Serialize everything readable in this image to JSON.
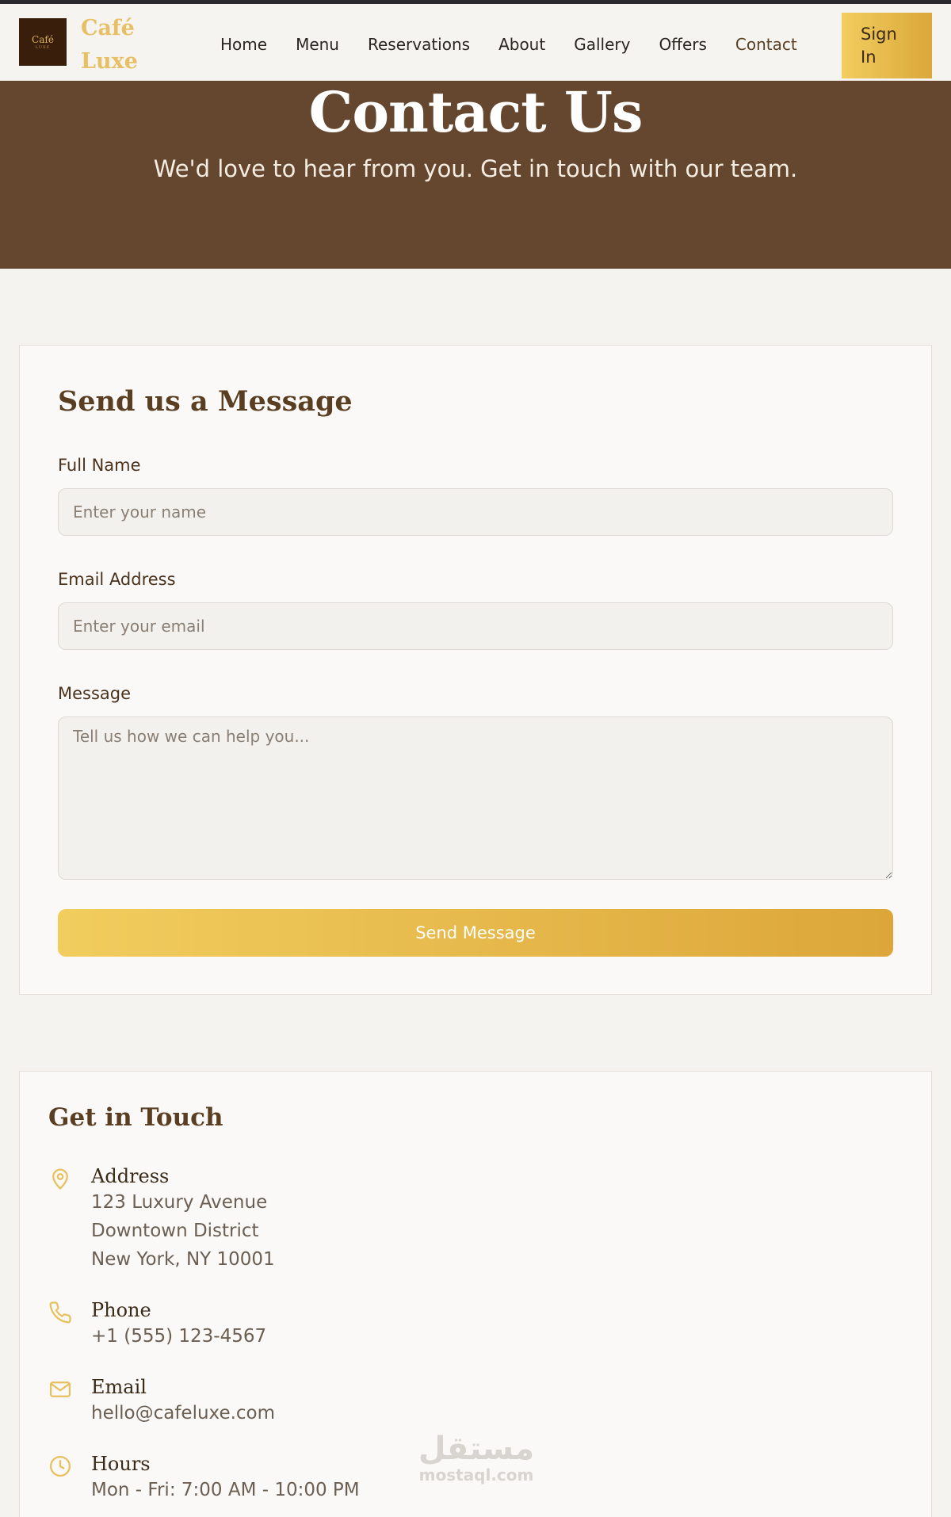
{
  "header": {
    "logo_line1": "Café",
    "logo_line2": "LUXE",
    "brand_line1": "Café",
    "brand_line2": "Luxe",
    "nav": [
      {
        "label": "Home"
      },
      {
        "label": "Menu"
      },
      {
        "label": "Reservations"
      },
      {
        "label": "About"
      },
      {
        "label": "Gallery"
      },
      {
        "label": "Offers"
      },
      {
        "label": "Contact",
        "active": true
      }
    ],
    "sign_in": "Sign In"
  },
  "hero": {
    "title": "Contact Us",
    "subtitle": "We'd love to hear from you. Get in touch with our team."
  },
  "form": {
    "title": "Send us a Message",
    "name_label": "Full Name",
    "name_placeholder": "Enter your name",
    "name_value": "",
    "email_label": "Email Address",
    "email_placeholder": "Enter your email",
    "email_value": "",
    "message_label": "Message",
    "message_placeholder": "Tell us how we can help you...",
    "message_value": "",
    "submit_label": "Send Message"
  },
  "contact": {
    "title": "Get in Touch",
    "address": {
      "title": "Address",
      "lines": [
        "123 Luxury Avenue",
        "Downtown District",
        "New York, NY 10001"
      ],
      "icon": "map-pin-icon"
    },
    "phone": {
      "title": "Phone",
      "lines": [
        "+1 (555) 123-4567"
      ],
      "icon": "phone-icon"
    },
    "email": {
      "title": "Email",
      "lines": [
        "hello@cafeluxe.com"
      ],
      "icon": "mail-icon"
    },
    "hours": {
      "title": "Hours",
      "lines": [
        "Mon - Fri: 7:00 AM - 10:00 PM"
      ],
      "icon": "clock-icon"
    }
  },
  "watermark": {
    "arabic": "مستقل",
    "latin": "mostaql.com"
  },
  "colors": {
    "accent_gold": "#e8c05e",
    "hero_brown": "#64472e",
    "heading_brown": "#5a3e22",
    "page_bg": "#f5f3ef"
  }
}
